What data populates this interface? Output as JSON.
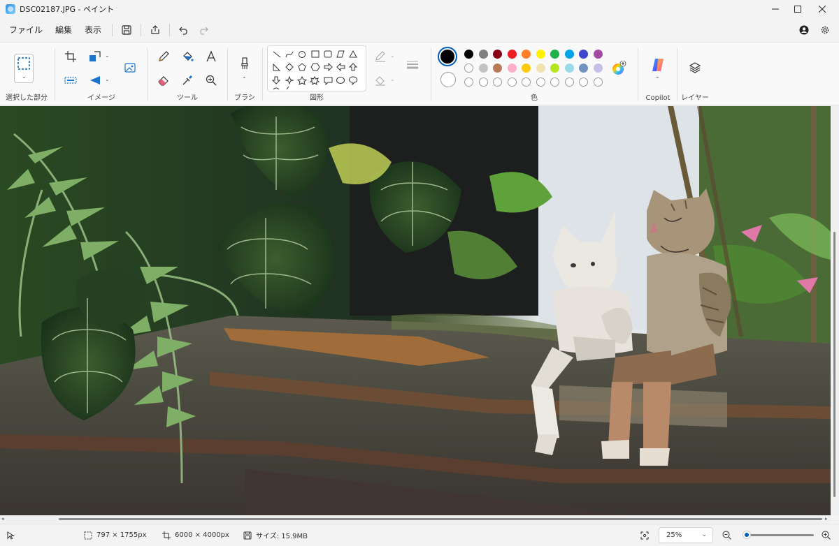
{
  "window": {
    "title": "DSC02187.JPG - ペイント"
  },
  "menu": {
    "file": "ファイル",
    "edit": "編集",
    "view": "表示"
  },
  "ribbon": {
    "selection_label": "選択した部分",
    "image_label": "イメージ",
    "tools_label": "ツール",
    "brush_label": "ブラシ",
    "shapes_label": "図形",
    "colors_label": "色",
    "copilot_label": "Copilot",
    "layers_label": "レイヤー"
  },
  "colors": {
    "primary": "#000000",
    "secondary": "#ffffff",
    "palette_row1": [
      "#000000",
      "#7f7f7f",
      "#880015",
      "#ed1c24",
      "#ff7f27",
      "#fff200",
      "#22b14c",
      "#00a2e8",
      "#3f48cc",
      "#a349a4"
    ],
    "palette_row2": [
      "#ffffff",
      "#c3c3c3",
      "#b97a57",
      "#ffaec9",
      "#ffc90e",
      "#efe4b0",
      "#b5e61d",
      "#99d9ea",
      "#7092be",
      "#c8bfe7"
    ],
    "accent": "#005fb8"
  },
  "status": {
    "selection_size": "797 × 1755px",
    "image_size": "6000 × 4000px",
    "file_size": "サイズ: 15.9MB",
    "zoom": "25%",
    "zoom_fraction": 0.04
  },
  "canvas": {
    "image_file": "DSC02187.JPG"
  }
}
